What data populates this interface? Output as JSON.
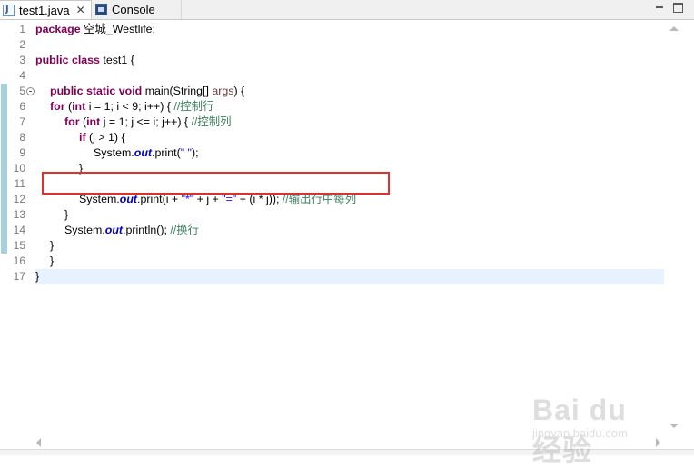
{
  "tabs": [
    {
      "label": "test1.java",
      "icon": "java-file-icon",
      "active": true,
      "close": "✕"
    },
    {
      "label": "Console",
      "icon": "console-icon",
      "active": false
    }
  ],
  "line_numbers": [
    "1",
    "2",
    "3",
    "4",
    "5",
    "6",
    "7",
    "8",
    "9",
    "10",
    "11",
    "12",
    "13",
    "14",
    "15",
    "16",
    "17"
  ],
  "code": {
    "l1_kw": "package",
    "l1_rest": " 空城_Westlife;",
    "l3_kw1": "public",
    "l3_kw2": "class",
    "l3_rest": " test1 {",
    "l5_kw1": "public",
    "l5_kw2": "static",
    "l5_kw3": "void",
    "l5_mid": " main(String[] ",
    "l5_param": "args",
    "l5_end": ") {",
    "l6_kw1": "for",
    "l6_a": " (",
    "l6_kw2": "int",
    "l6_b": " i = 1; i < 9; i++) { ",
    "l6_cmt": "//控制行",
    "l7_kw1": "for",
    "l7_a": " (",
    "l7_kw2": "int",
    "l7_b": " j = 1; j <= i; j++) { ",
    "l7_cmt": "//控制列",
    "l8_kw": "if",
    "l8_rest": " (j > 1) {",
    "l9_a": "System.",
    "l9_fld": "out",
    "l9_b": ".print(",
    "l9_str": "\" \"",
    "l9_c": ");",
    "l10": "}",
    "l11_a": "System.",
    "l11_fld": "out",
    "l11_b": ".print(i + ",
    "l11_s1": "\"*\"",
    "l11_c": " + j + ",
    "l11_s2": "\"=\"",
    "l11_d": " + (i * j)); ",
    "l11_cmt": "//输出行中每列",
    "l12": "}",
    "l13_a": "System.",
    "l13_fld": "out",
    "l13_b": ".println(); ",
    "l13_cmt": "//换行",
    "l14": "}",
    "l15": "}",
    "l16": "}"
  },
  "watermark": {
    "main": "Bai du 经验",
    "sub": "jingyan.baidu.com"
  },
  "colors": {
    "keyword": "#7f0055",
    "comment": "#3f7f5f",
    "string": "#2a00ff",
    "field": "#0000c0",
    "current_line": "#e8f2fe",
    "highlight_border": "#e0302e"
  }
}
